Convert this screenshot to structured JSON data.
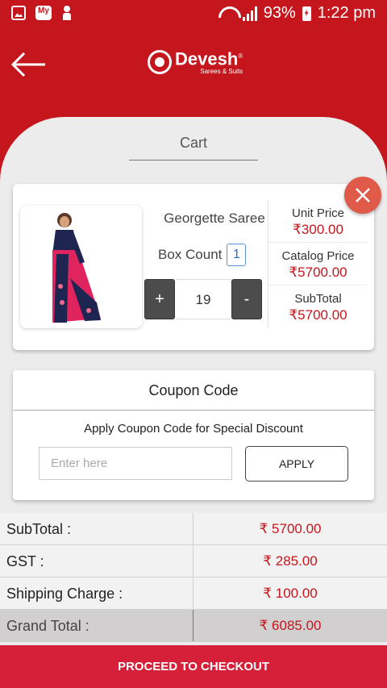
{
  "status_bar": {
    "battery": "93%",
    "time": "1:22 pm",
    "icons": [
      "gallery-icon",
      "myjio-icon",
      "person-icon",
      "wifi-icon",
      "signal-icon",
      "battery-icon"
    ],
    "myjio_label": "My"
  },
  "header": {
    "brand": "Devesh",
    "tagline": "Sarees & Suits",
    "reg": "®"
  },
  "page": {
    "title": "Cart"
  },
  "product": {
    "name": "Georgette Saree",
    "box_count_label": "Box Count",
    "box_count": "1",
    "quantity": "19",
    "plus": "+",
    "minus": "-",
    "unit_price_label": "Unit Price",
    "unit_price": "₹300.00",
    "catalog_price_label": "Catalog Price",
    "catalog_price": "₹5700.00",
    "subtotal_label": "SubTotal",
    "subtotal": "₹5700.00"
  },
  "coupon": {
    "title": "Coupon Code",
    "subtitle": "Apply Coupon Code for Special Discount",
    "placeholder": "Enter here",
    "apply_label": "APPLY"
  },
  "totals": [
    {
      "label": "SubTotal :",
      "value": "₹ 5700.00"
    },
    {
      "label": "GST :",
      "value": "₹ 285.00"
    },
    {
      "label": "Shipping Charge :",
      "value": "₹ 100.00"
    },
    {
      "label": "Grand Total :",
      "value": "₹ 6085.00"
    }
  ],
  "checkout": {
    "label": "PROCEED TO CHECKOUT"
  },
  "colors": {
    "brand": "#c4161c",
    "checkout": "#d6203a",
    "close": "#e05a4a"
  }
}
